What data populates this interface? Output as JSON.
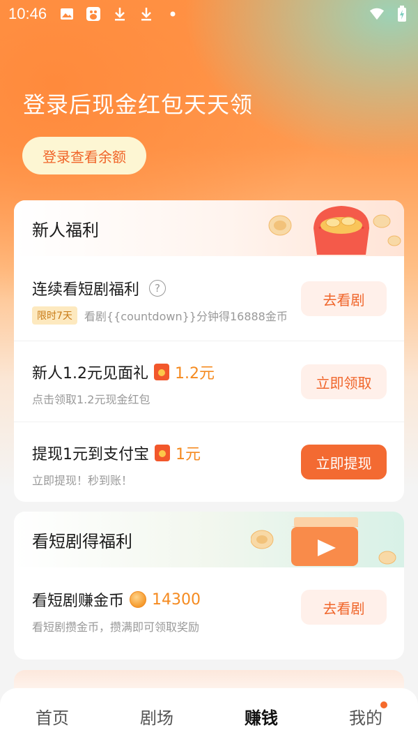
{
  "status_bar": {
    "time": "10:46",
    "icons": [
      "image-icon",
      "baidu-icon",
      "download-icon",
      "download-icon",
      "dot-icon"
    ],
    "right_icons": [
      "wifi-icon",
      "battery-charging-icon"
    ]
  },
  "hero": {
    "title": "登录后现金红包天天领",
    "login_button": "登录查看余额"
  },
  "newbie_card": {
    "title": "新人福利",
    "rows": [
      {
        "title": "连续看短剧福利",
        "tag": "限时7天",
        "subtitle": "看剧{{countdown}}分钟得16888金币",
        "button": "去看剧"
      },
      {
        "title": "新人1.2元见面礼",
        "reward": "1.2元",
        "subtitle": "点击领取1.2元现金红包",
        "button": "立即领取"
      },
      {
        "title": "提现1元到支付宝",
        "reward": "1元",
        "subtitle": "立即提现！秒到账！",
        "button": "立即提现"
      }
    ]
  },
  "drama_card": {
    "title": "看短剧得福利",
    "rows": [
      {
        "title": "看短剧赚金币",
        "reward": "14300",
        "subtitle": "看短剧攒金币，攒满即可领取奖励",
        "button": "去看剧"
      }
    ]
  },
  "tabbar": {
    "tabs": [
      "首页",
      "剧场",
      "赚钱",
      "我的"
    ],
    "active_index": 2
  },
  "colors": {
    "accent": "#f36a32",
    "reward": "#f58a1f",
    "hero_orange": "#ff8a3c"
  }
}
